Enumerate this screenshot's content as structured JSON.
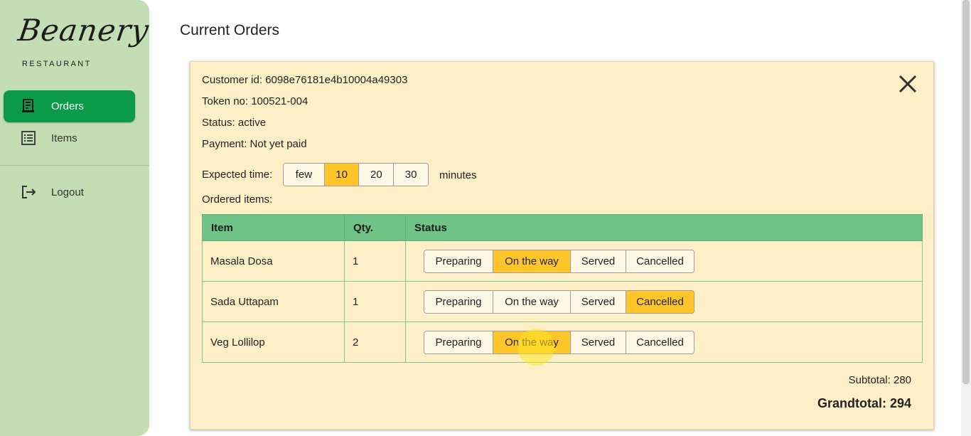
{
  "brand": {
    "name": "Beanery",
    "subtitle": "RESTAURANT"
  },
  "sidebar": {
    "items": [
      {
        "label": "Orders",
        "icon": "receipt-icon",
        "active": true
      },
      {
        "label": "Items",
        "icon": "list-icon",
        "active": false
      },
      {
        "label": "Logout",
        "icon": "logout-icon",
        "active": false
      }
    ]
  },
  "page": {
    "title": "Current Orders"
  },
  "order": {
    "customer_id": "Customer id: 6098e76181e4b10004a49303",
    "token": "Token no: 100521-004",
    "status": "Status: active",
    "payment": "Payment: Not yet paid",
    "expected_time_label": "Expected time:",
    "expected_time_options": [
      "few",
      "10",
      "20",
      "30"
    ],
    "expected_time_selected": "10",
    "minutes_label": "minutes",
    "ordered_items_label": "Ordered items:",
    "table": {
      "headers": [
        "Item",
        "Qty.",
        "Status"
      ],
      "status_options": [
        "Preparing",
        "On the way",
        "Served",
        "Cancelled"
      ],
      "rows": [
        {
          "item": "Masala Dosa",
          "qty": "1",
          "status": "On the way"
        },
        {
          "item": "Sada Uttapam",
          "qty": "1",
          "status": "Cancelled"
        },
        {
          "item": "Veg Lollilop",
          "qty": "2",
          "status": "On the way"
        }
      ]
    },
    "subtotal": "Subtotal: 280",
    "grandtotal": "Grandtotal: 294"
  },
  "colors": {
    "sidebar_bg": "#c3ddb4",
    "active_nav": "#0a9a48",
    "card_bg": "#ffefc6",
    "table_header": "#6fc387",
    "selected_option": "#ffc529"
  }
}
